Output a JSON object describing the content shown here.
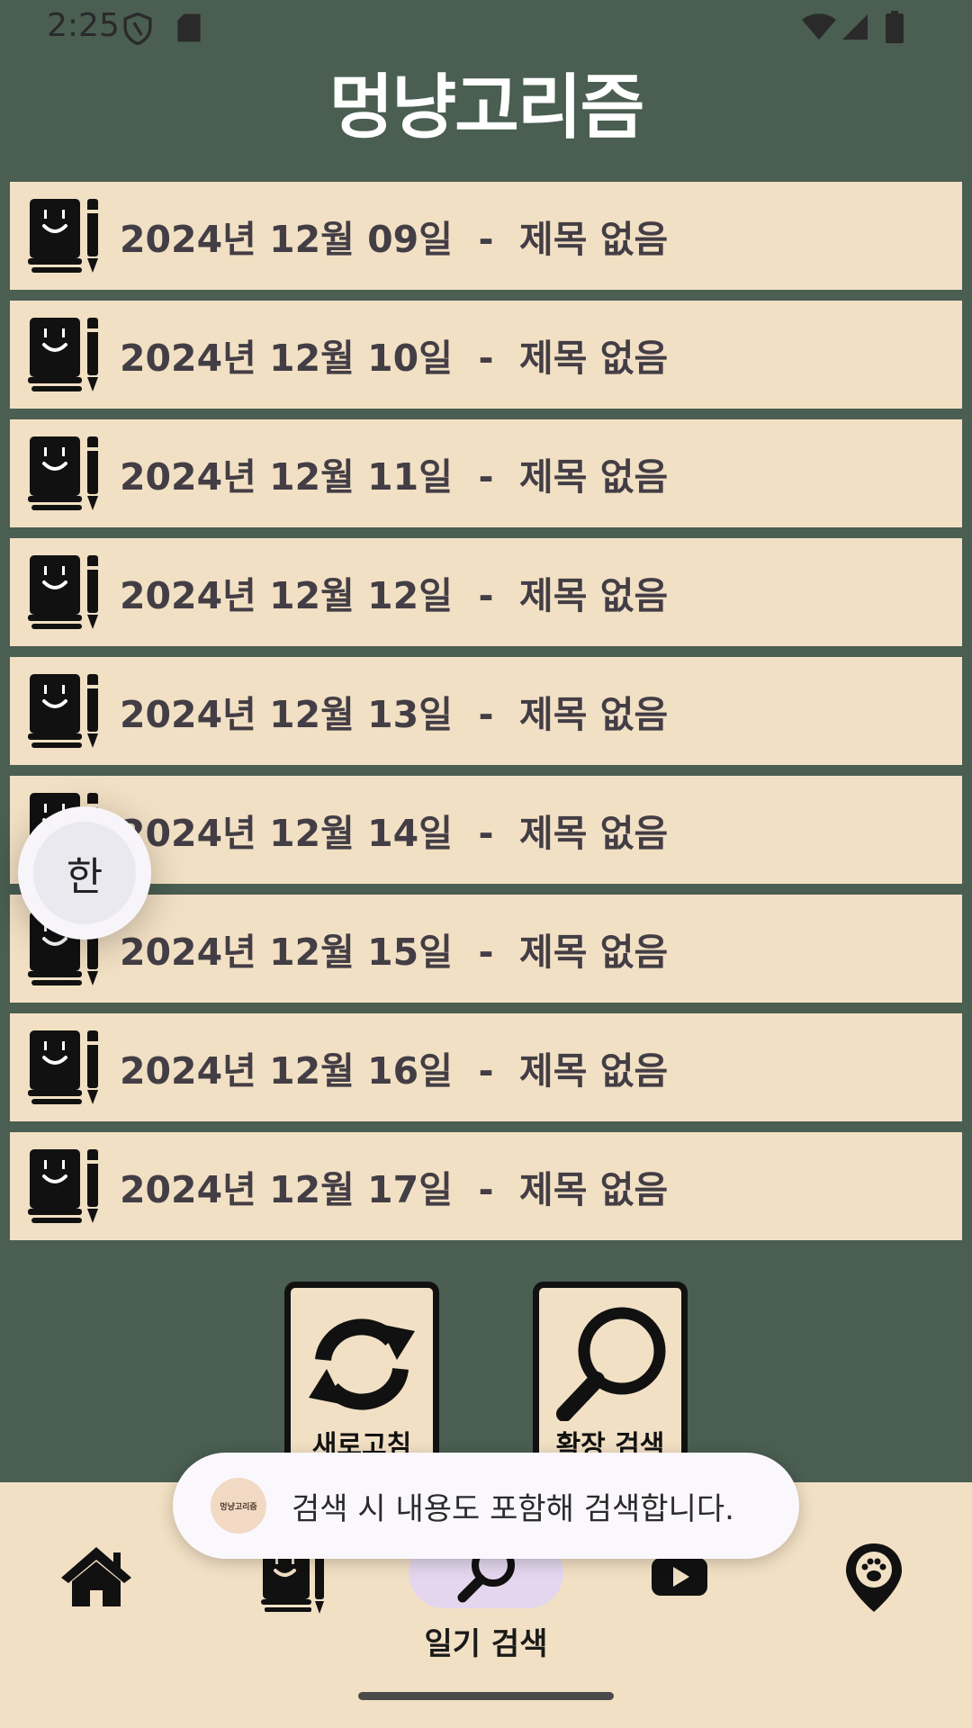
{
  "status_bar": {
    "time": "2:25",
    "icons": [
      "shield-icon",
      "sd-card-icon",
      "wifi-icon",
      "signal-icon",
      "battery-icon"
    ]
  },
  "app": {
    "title": "멍냥고리즘"
  },
  "diary_entries": [
    {
      "label": "2024년 12월 09일  -  제목 없음"
    },
    {
      "label": "2024년 12월 10일  -  제목 없음"
    },
    {
      "label": "2024년 12월 11일  -  제목 없음"
    },
    {
      "label": "2024년 12월 12일  -  제목 없음"
    },
    {
      "label": "2024년 12월 13일  -  제목 없음"
    },
    {
      "label": "2024년 12월 14일  -  제목 없음"
    },
    {
      "label": "2024년 12월 15일  -  제목 없음"
    },
    {
      "label": "2024년 12월 16일  -  제목 없음"
    },
    {
      "label": "2024년 12월 17일  -  제목 없음"
    }
  ],
  "ime_bubble": {
    "label": "한"
  },
  "actions": {
    "refresh_label": "새로고침",
    "extended_search_label": "확장 검색"
  },
  "toast": {
    "logo_text": "멍냥고리즘",
    "message": "검색 시 내용도 포함해 검색합니다."
  },
  "bottom_nav": {
    "active_label": "일기 검색",
    "items": [
      "home-icon",
      "diary-icon",
      "search-icon",
      "video-icon",
      "map-pin-paw-icon"
    ]
  },
  "colors": {
    "background": "#4a5e52",
    "card": "#f2e0c4",
    "text": "#433e45",
    "active_pill": "#e4d6ee"
  }
}
